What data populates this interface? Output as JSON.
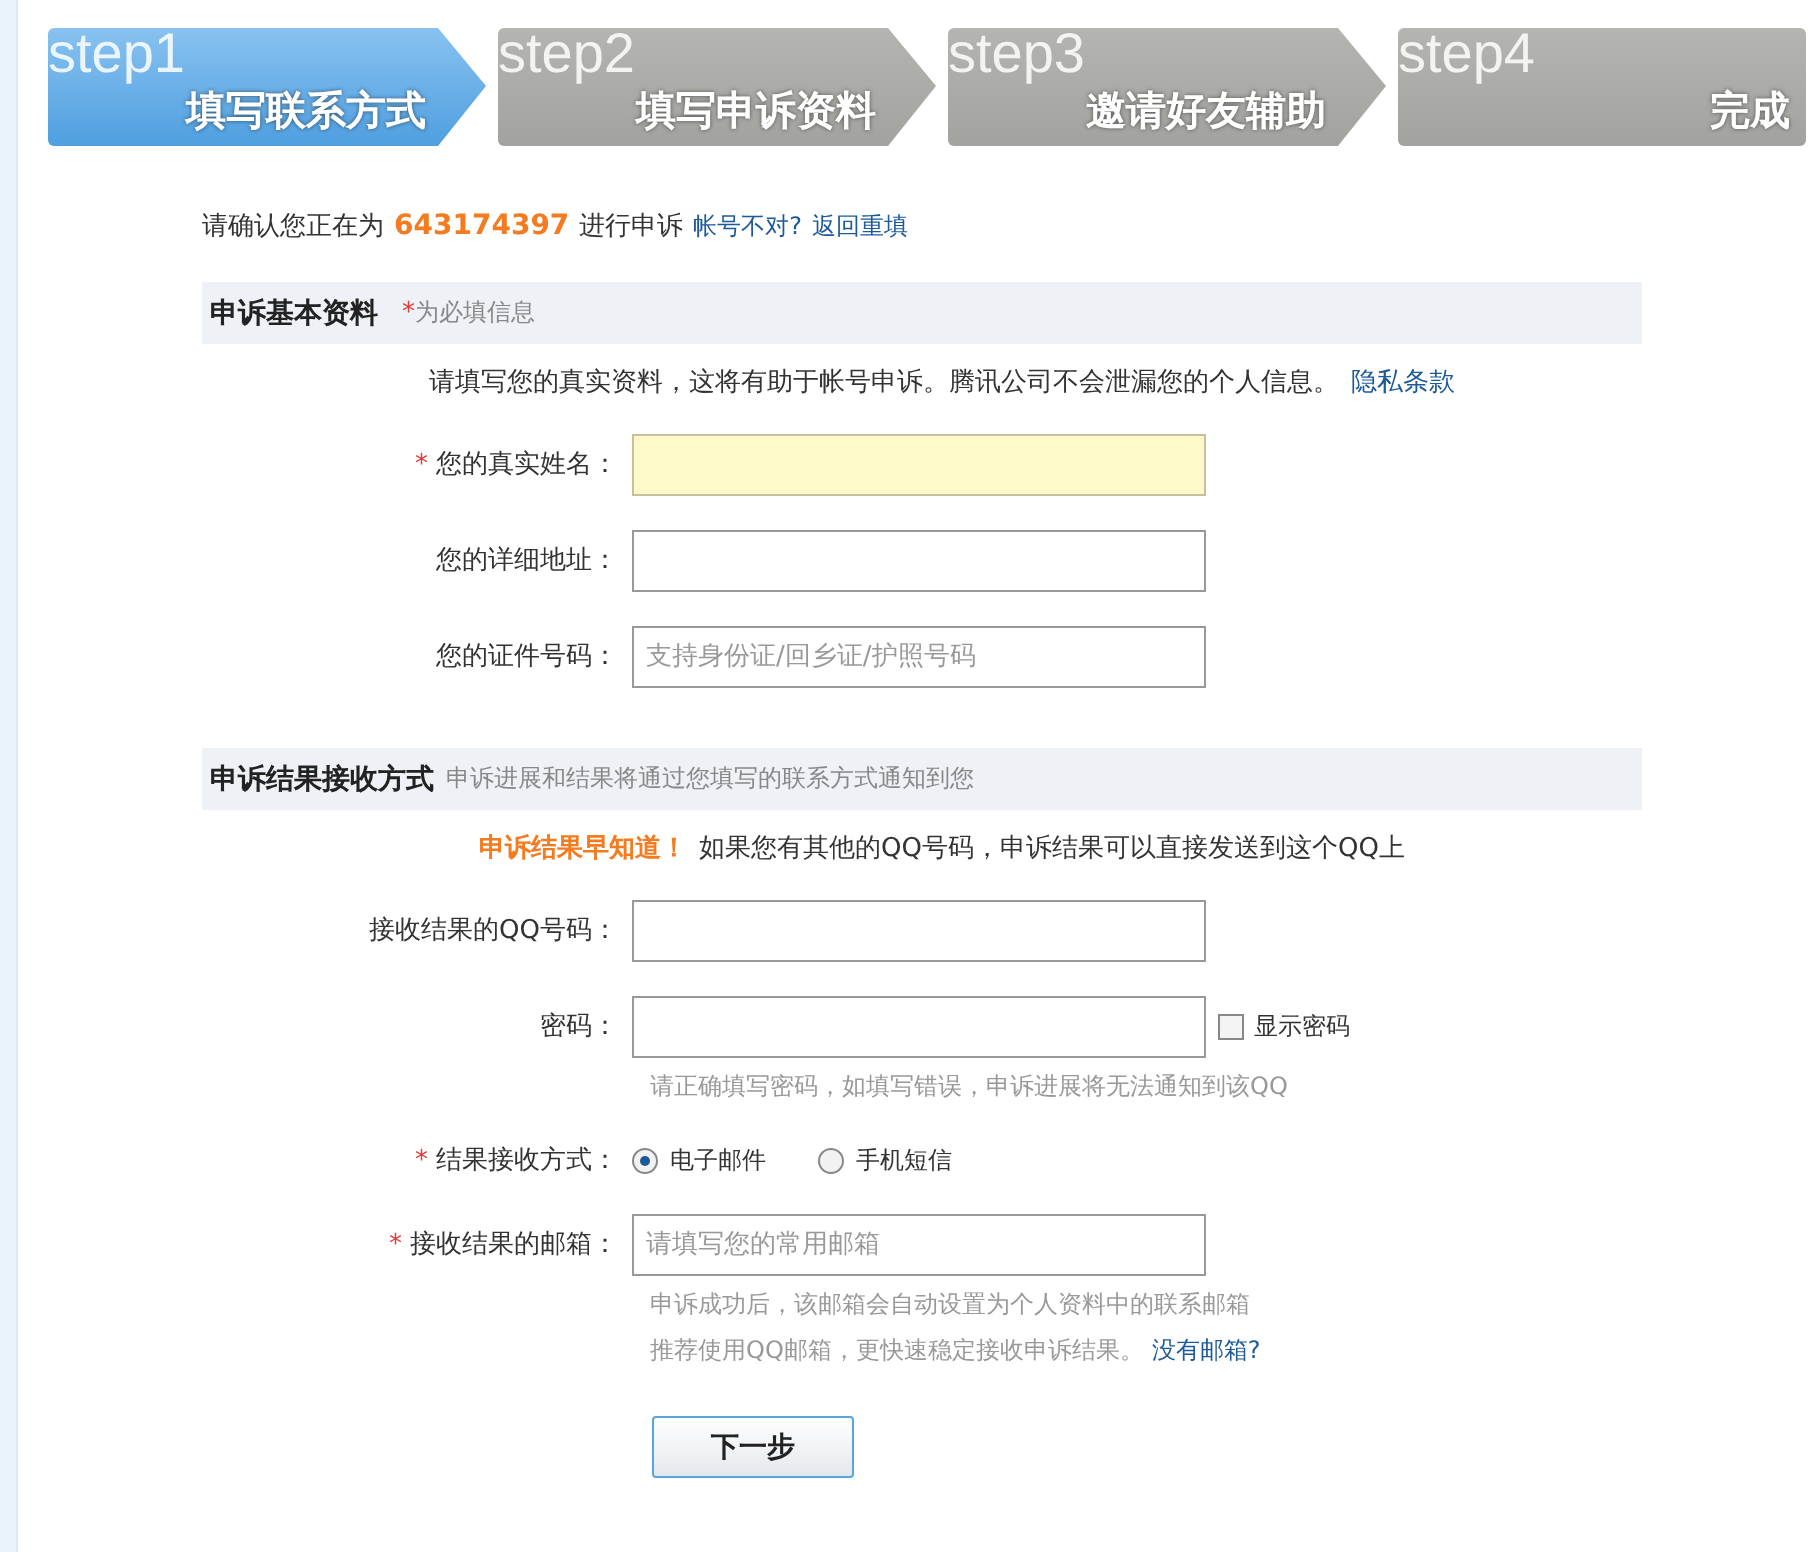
{
  "steps": [
    {
      "step": "step1",
      "title": "填写联系方式",
      "selected": true
    },
    {
      "step": "step2",
      "title": "填写申诉资料",
      "selected": false
    },
    {
      "step": "step3",
      "title": "邀请好友辅助",
      "selected": false
    },
    {
      "step": "step4",
      "title": "完成",
      "selected": false
    }
  ],
  "confirm": {
    "before": "请确认您正在为",
    "account": "643174397",
    "after": "进行申诉",
    "links": [
      "帐号不对?",
      "返回重填"
    ]
  },
  "sections": [
    {
      "title": "申诉基本资料",
      "mark": "*",
      "note": "为必填信息",
      "intro": "请填写您的真实资料，这将有助于帐号申诉。腾讯公司不会泄漏您的个人信息。",
      "intro_link": "隐私条款",
      "fields": [
        {
          "kind": "input",
          "label": "您的真实姓名：",
          "required": true,
          "highlighted": true
        },
        {
          "kind": "input",
          "label": "您的详细地址：",
          "required": false,
          "highlighted": false
        },
        {
          "kind": "input",
          "label": "您的证件号码：",
          "required": false,
          "highlighted": false,
          "placeholder": "支持身份证/回乡证/护照号码"
        }
      ]
    },
    {
      "title": "申诉结果接收方式",
      "note": "申诉进展和结果将通过您填写的联系方式通知到您",
      "intro": "如果您有其他的QQ号码，申诉结果可以直接发送到这个QQ上",
      "intro_highlight": "申诉结果早知道！",
      "fields": [
        {
          "kind": "input",
          "label": "接收结果的QQ号码：",
          "required": false,
          "highlighted": false
        },
        {
          "kind": "input",
          "label": "密码：",
          "required": false,
          "highlighted": false,
          "checkbox": {
            "label": "显示密码",
            "checked": false
          },
          "hints": [
            "请正确填写密码，如填写错误，申诉进展将无法通知到该QQ"
          ]
        },
        {
          "kind": "radio",
          "label": "结果接收方式：",
          "required": true,
          "options": [
            {
              "label": "电子邮件",
              "selected": true
            },
            {
              "label": "手机短信",
              "selected": false
            }
          ]
        },
        {
          "kind": "input",
          "label": "接收结果的邮箱：",
          "required": true,
          "highlighted": false,
          "placeholder": "请填写您的常用邮箱",
          "hints": [
            "申诉成功后，该邮箱会自动设置为个人资料中的联系邮箱",
            "推荐使用QQ邮箱，更快速稳定接收申诉结果。"
          ],
          "hint_link": "没有邮箱?"
        }
      ]
    }
  ],
  "submit": "下一步"
}
